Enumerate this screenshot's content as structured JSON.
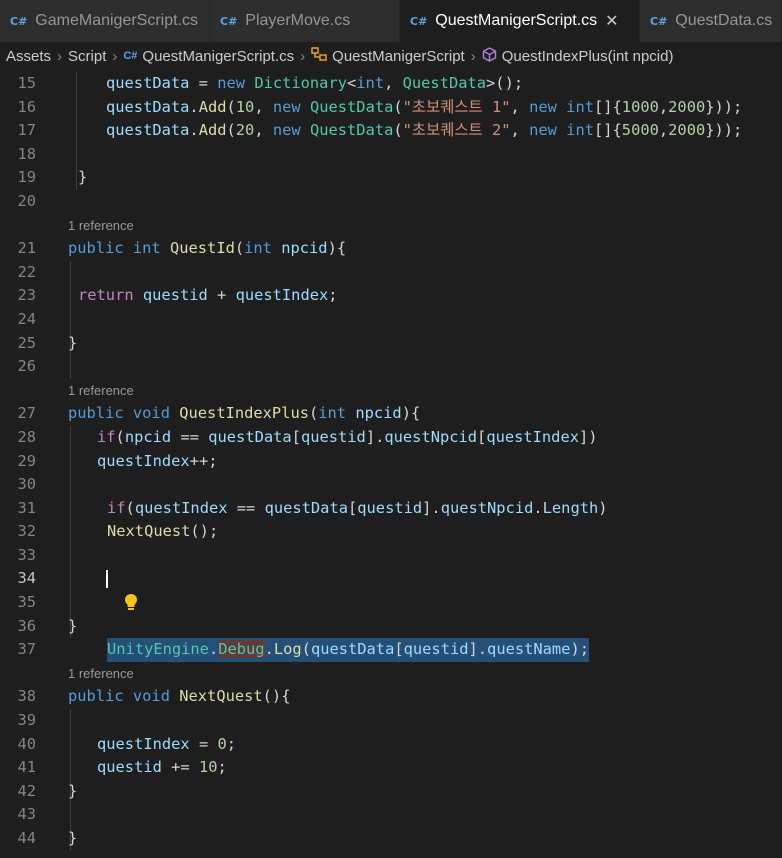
{
  "tabs": [
    {
      "name": "GameManigerScript.cs",
      "active": false
    },
    {
      "name": "PlayerMove.cs",
      "active": false
    },
    {
      "name": "QuestManigerScript.cs",
      "active": true
    },
    {
      "name": "QuestData.cs",
      "active": false
    }
  ],
  "tab_icon_text": "C#",
  "close_glyph": "✕",
  "breadcrumb": {
    "assets": "Assets",
    "script": "Script",
    "file": "QuestManigerScript.cs",
    "class": "QuestManigerScript",
    "method": "QuestIndexPlus(int npcid)"
  },
  "reference_label": "1 reference",
  "lines": [
    {
      "n": "15"
    },
    {
      "n": "16"
    },
    {
      "n": "17"
    },
    {
      "n": "18"
    },
    {
      "n": "19"
    },
    {
      "n": "20"
    },
    {
      "n": "21"
    },
    {
      "n": "22"
    },
    {
      "n": "23"
    },
    {
      "n": "24"
    },
    {
      "n": "25"
    },
    {
      "n": "26"
    },
    {
      "n": "27"
    },
    {
      "n": "28"
    },
    {
      "n": "29"
    },
    {
      "n": "30"
    },
    {
      "n": "31"
    },
    {
      "n": "32"
    },
    {
      "n": "33"
    },
    {
      "n": "34"
    },
    {
      "n": "35"
    },
    {
      "n": "36"
    },
    {
      "n": "37"
    },
    {
      "n": "38"
    },
    {
      "n": "39"
    },
    {
      "n": "40"
    },
    {
      "n": "41"
    },
    {
      "n": "42"
    },
    {
      "n": "43"
    },
    {
      "n": "44"
    }
  ],
  "code": {
    "l15": [
      "questData",
      " = ",
      "new",
      " ",
      "Dictionary",
      "<",
      "int",
      ", ",
      "QuestData",
      ">();"
    ],
    "l16": [
      "questData",
      ".",
      "Add",
      "(",
      "10",
      ", ",
      "new",
      " ",
      "QuestData",
      "(",
      "\"초보퀘스트 1\"",
      ", ",
      "new",
      " ",
      "int",
      "[]{",
      "1000",
      ",",
      "2000",
      "}));"
    ],
    "l17": [
      "questData",
      ".",
      "Add",
      "(",
      "20",
      ", ",
      "new",
      " ",
      "QuestData",
      "(",
      "\"초보퀘스트 2\"",
      ", ",
      "new",
      " ",
      "int",
      "[]{",
      "5000",
      ",",
      "2000",
      "}));"
    ],
    "l19": "}",
    "l21": [
      "public",
      " ",
      "int",
      " ",
      "QuestId",
      "(",
      "int",
      " ",
      "npcid",
      "){"
    ],
    "l23": [
      "return",
      " ",
      "questid",
      " + ",
      "questIndex",
      ";"
    ],
    "l25": "}",
    "l27": [
      "public",
      " ",
      "void",
      " ",
      "QuestIndexPlus",
      "(",
      "int",
      " ",
      "npcid",
      "){"
    ],
    "l28": [
      "if",
      "(",
      "npcid",
      " == ",
      "questData",
      "[",
      "questid",
      "].",
      "questNpcid",
      "[",
      "questIndex",
      "])"
    ],
    "l29": [
      "questIndex",
      "++;"
    ],
    "l31": [
      "if",
      "(",
      "questIndex",
      " == ",
      "questData",
      "[",
      "questid",
      "].",
      "questNpcid",
      ".",
      "Length",
      ")"
    ],
    "l32": [
      "NextQuest",
      "();"
    ],
    "l34": [
      "UnityEngine",
      ".",
      "Debug",
      ".",
      "Log",
      "(",
      "questData",
      "[",
      "questid",
      "].",
      "questName",
      ");"
    ],
    "l36": "}",
    "l38": [
      "public",
      " ",
      "void",
      " ",
      "NextQuest",
      "(){"
    ],
    "l40": [
      "questIndex",
      " = ",
      "0",
      ";"
    ],
    "l41": [
      "questid",
      " += ",
      "10",
      ";"
    ],
    "l42": "}",
    "l44": "}"
  },
  "colors": {
    "keyword": "#569cd6",
    "type": "#4ec9b0",
    "string": "#ce9178",
    "number": "#b5cea8",
    "function": "#dcdcaa",
    "variable": "#9cdcfe",
    "selection": "#264f78"
  },
  "icons": [
    "csharp-file-icon",
    "close-icon",
    "class-icon",
    "method-icon",
    "lightbulb-icon",
    "chevron-right-icon"
  ]
}
